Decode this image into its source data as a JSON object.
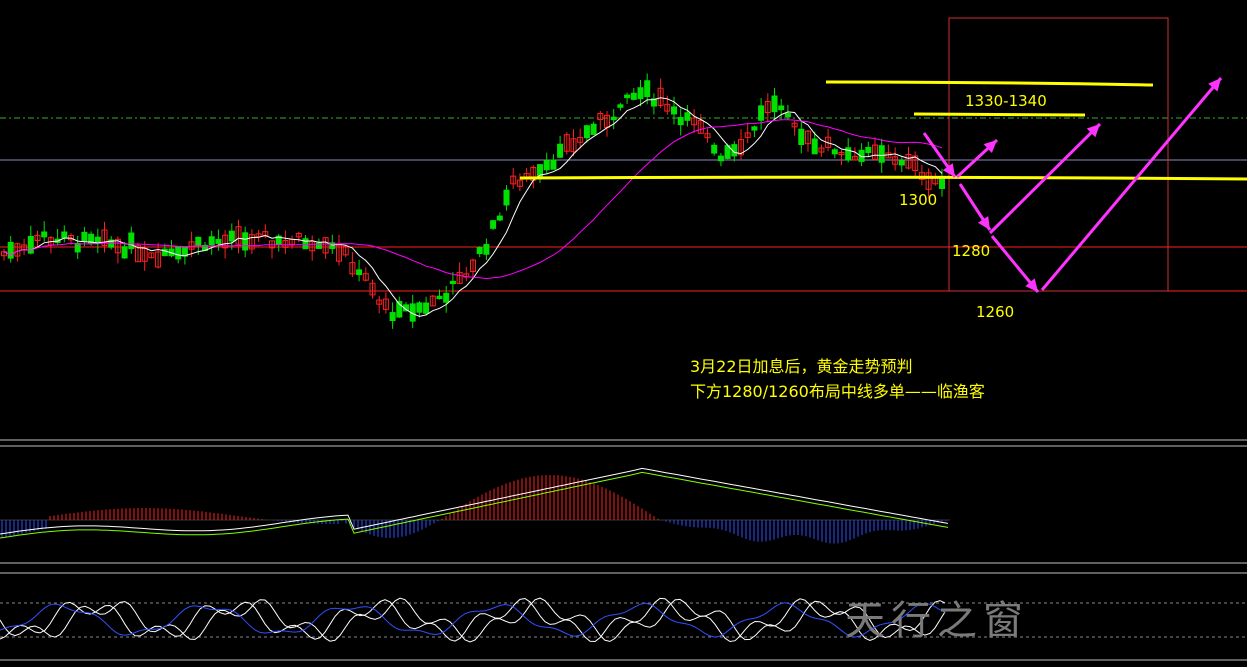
{
  "chart_data": {
    "type": "candlestick",
    "colors": {
      "up": "#ff2020",
      "down": "#00e000",
      "ma_fast": "#ffffff",
      "ma_slow": "#ff00ff",
      "level": "#ffff00",
      "arrow": "#ff33ff",
      "redline": "#ff2020"
    },
    "price_labels": {
      "p1300": "1300",
      "p1280": "1280",
      "p1260": "1260",
      "range": "1330-1340"
    },
    "levels": [
      1330,
      1340,
      1300,
      1280,
      1260
    ],
    "annotation": {
      "line1": "3月22日加息后，黄金走势预判",
      "line2": "下方1280/1260布局中线多单——临渔客"
    },
    "watermark": "天行之窗"
  }
}
